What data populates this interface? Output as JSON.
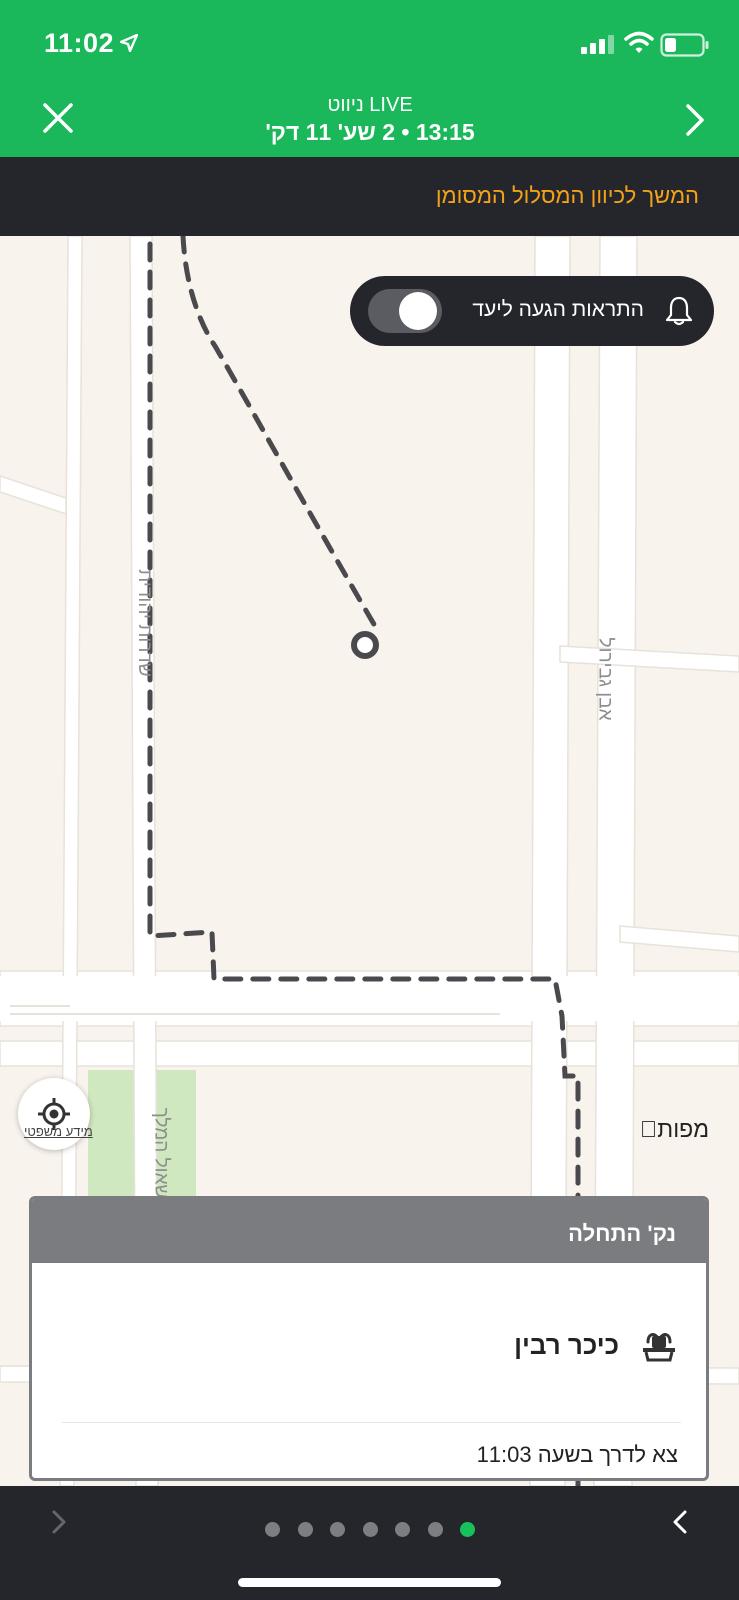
{
  "status_bar": {
    "time": "11:02"
  },
  "header": {
    "title": "ניווט LIVE",
    "subtitle": "13:15 • 2 שע'  11 דק'"
  },
  "banner": {
    "text": "המשך לכיוון המסלול המסומן"
  },
  "map": {
    "alert_toggle_label": "התראות הגעה ליעד",
    "alert_toggle_on": false,
    "street_left": "שדרות יהודית",
    "street_right": "אבן גבירול",
    "street_bottom": "שאול המלך",
    "legal_link": "מידע משפטי",
    "maps_brand": "מפות"
  },
  "card": {
    "header": "נק' התחלה",
    "place_name": "כיכר רבין",
    "depart": "צא לדרך בשעה 11:03"
  },
  "pager": {
    "total_pages": 7,
    "active_index": 6
  },
  "colors": {
    "brand_green": "#1ab85b",
    "banner_text": "#f3a317",
    "dark": "#25262c"
  }
}
